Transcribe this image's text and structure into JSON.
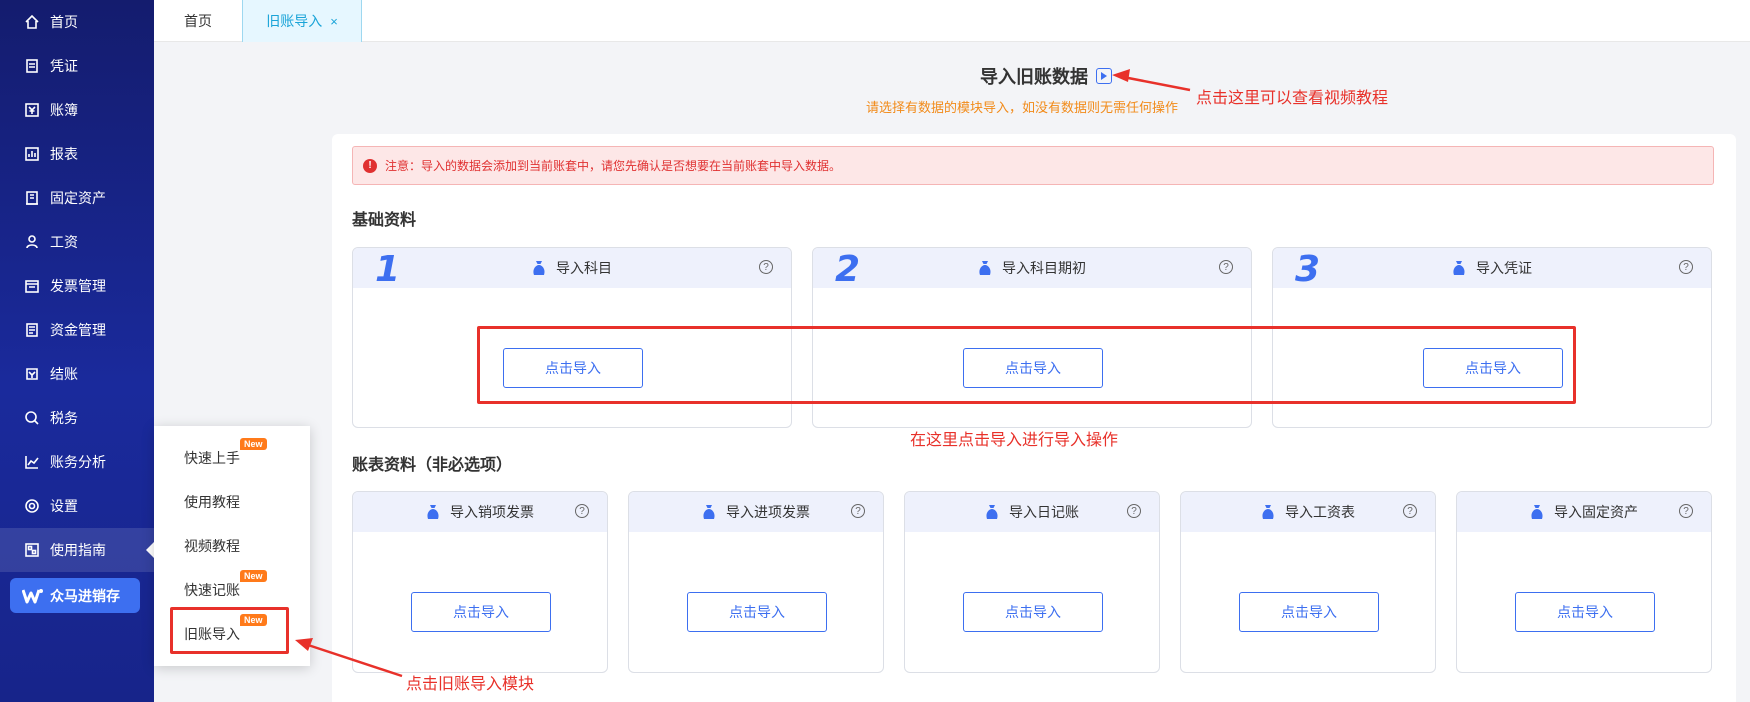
{
  "sidebar": {
    "items": [
      {
        "label": "首页",
        "icon": "home-icon"
      },
      {
        "label": "凭证",
        "icon": "voucher-icon"
      },
      {
        "label": "账簿",
        "icon": "ledger-icon"
      },
      {
        "label": "报表",
        "icon": "report-icon"
      },
      {
        "label": "固定资产",
        "icon": "asset-icon"
      },
      {
        "label": "工资",
        "icon": "salary-icon"
      },
      {
        "label": "发票管理",
        "icon": "invoice-icon"
      },
      {
        "label": "资金管理",
        "icon": "fund-icon"
      },
      {
        "label": "结账",
        "icon": "closing-icon"
      },
      {
        "label": "税务",
        "icon": "tax-icon"
      },
      {
        "label": "账务分析",
        "icon": "analysis-icon"
      },
      {
        "label": "设置",
        "icon": "settings-icon"
      },
      {
        "label": "使用指南",
        "icon": "guide-icon"
      }
    ],
    "promo": "众马进销存"
  },
  "guide_menu": {
    "items": [
      {
        "label": "快速上手",
        "badge": "New"
      },
      {
        "label": "使用教程",
        "badge": ""
      },
      {
        "label": "视频教程",
        "badge": ""
      },
      {
        "label": "快速记账",
        "badge": "New"
      },
      {
        "label": "旧账导入",
        "badge": "New"
      }
    ]
  },
  "tabs": {
    "home": "首页",
    "active": "旧账导入",
    "close": "×"
  },
  "header": {
    "title": "导入旧账数据",
    "subtitle": "请选择有数据的模块导入，如没有数据则无需任何操作"
  },
  "alert": {
    "icon": "!",
    "text": "注意：导入的数据会添加到当前账套中，请您先确认是否想要在当前账套中导入数据。"
  },
  "basic": {
    "title": "基础资料",
    "cards": [
      {
        "num": "1",
        "title": "导入科目",
        "button": "点击导入"
      },
      {
        "num": "2",
        "title": "导入科目期初",
        "button": "点击导入"
      },
      {
        "num": "3",
        "title": "导入凭证",
        "button": "点击导入"
      }
    ]
  },
  "optional": {
    "title": "账表资料（非必选项）",
    "cards": [
      {
        "title": "导入销项发票",
        "button": "点击导入"
      },
      {
        "title": "导入进项发票",
        "button": "点击导入"
      },
      {
        "title": "导入日记账",
        "button": "点击导入"
      },
      {
        "title": "导入工资表",
        "button": "点击导入"
      },
      {
        "title": "导入固定资产",
        "button": "点击导入"
      }
    ]
  },
  "help_glyph": "?",
  "annotations": {
    "video": "点击这里可以查看视频教程",
    "import": "在这里点击导入进行导入操作",
    "module": "点击旧账导入模块"
  },
  "colors": {
    "accent": "#3d6ff0",
    "annotation": "#e8312a",
    "sidebar": "#1a2a9c",
    "badge": "#ff7a1a",
    "subtitle": "#f28b1a"
  }
}
